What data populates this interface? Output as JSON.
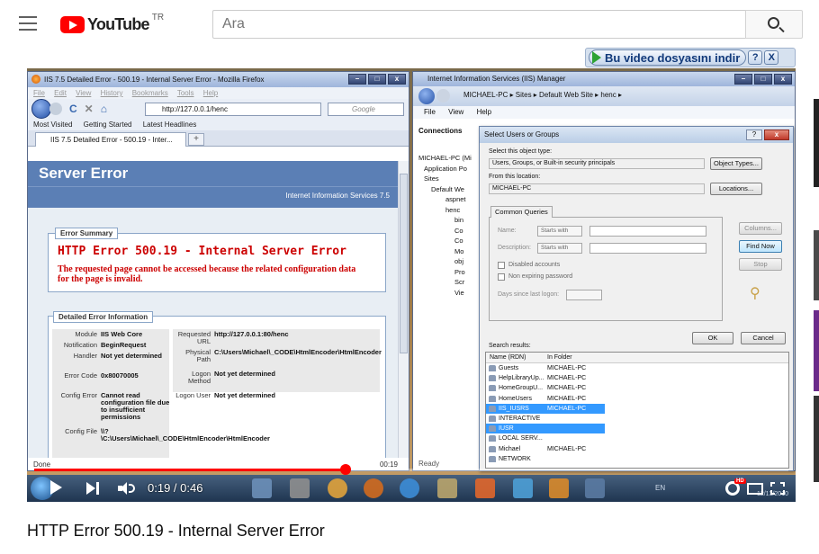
{
  "header": {
    "logo_text": "YouTube",
    "region": "TR",
    "search_placeholder": "Ara"
  },
  "download_bar": {
    "label": "Bu video dosyasını indir",
    "help": "?",
    "close": "X"
  },
  "player": {
    "time_current": "0:19",
    "time_total": "0:46",
    "progress_fraction": 0.413,
    "accent": "#ff0000"
  },
  "video_frame": {
    "firefox": {
      "window_title": "IIS 7.5 Detailed Error - 500.19 - Internal Server Error - Mozilla Firefox",
      "menu": [
        "File",
        "Edit",
        "View",
        "History",
        "Bookmarks",
        "Tools",
        "Help"
      ],
      "url": "http://127.0.0.1/henc",
      "search_engine": "Google",
      "bookmarks": [
        "Most Visited",
        "Getting Started",
        "Latest Headlines"
      ],
      "tab_title": "IIS 7.5 Detailed Error - 500.19 - Inter...",
      "tab_plus": "+",
      "server_error": "Server Error",
      "iis_version": "Internet Information Services 7.5",
      "error_summary_label": "Error Summary",
      "error_heading": "HTTP Error 500.19 - Internal Server Error",
      "error_message": "The requested page cannot be accessed because the related configuration data for the page is invalid.",
      "detailed_label": "Detailed Error Information",
      "details_left": [
        {
          "k": "Module",
          "v": "IIS Web Core"
        },
        {
          "k": "Notification",
          "v": "BeginRequest"
        },
        {
          "k": "Handler",
          "v": "Not yet determined"
        },
        {
          "k": "Error Code",
          "v": "0x80070005"
        },
        {
          "k": "Config Error",
          "v": "Cannot read configuration file due to insufficient permissions"
        },
        {
          "k": "Config File",
          "v": "\\\\?\\C:\\Users\\Michael\\_CODE\\HtmlEncoder\\HtmlEncoder"
        }
      ],
      "details_right": [
        {
          "k": "Requested URL",
          "v": "http://127.0.0.1:80/henc"
        },
        {
          "k": "Physical Path",
          "v": "C:\\Users\\Michael\\_CODE\\HtmlEncoder\\HtmlEncoder"
        },
        {
          "k": "Logon Method",
          "v": "Not yet determined"
        },
        {
          "k": "Logon User",
          "v": "Not yet determined"
        }
      ],
      "status": "Done",
      "status_time": "00:19"
    },
    "iis_manager": {
      "window_title": "Internet Information Services (IIS) Manager",
      "crumbs": "MICHAEL-PC  ▸  Sites  ▸  Default Web Site  ▸  henc  ▸",
      "menu": [
        "File",
        "View",
        "Help"
      ],
      "connections": "Connections",
      "tree": [
        "MICHAEL-PC (Mi",
        "Application Po",
        "Sites",
        "Default We",
        "aspnet",
        "henc",
        "bin",
        "Co",
        "Co",
        "Mo",
        "obj",
        "Pro",
        "Scr",
        "Vie"
      ],
      "status": "Ready"
    },
    "dialog": {
      "title": "Select Users or Groups",
      "object_type_label": "Select this object type:",
      "object_type_value": "Users, Groups, or Built-in security principals",
      "object_types_button": "Object Types...",
      "location_label": "From this location:",
      "location_value": "MICHAEL-PC",
      "locations_button": "Locations...",
      "tab_common": "Common Queries",
      "name_label": "Name:",
      "description_label": "Description:",
      "starts_with": "Starts with",
      "disabled_accounts": "Disabled accounts",
      "non_expiring": "Non expiring password",
      "days_since": "Days since last logon:",
      "columns_button": "Columns...",
      "find_now_button": "Find Now",
      "stop_button": "Stop",
      "ok_button": "OK",
      "cancel_button": "Cancel",
      "search_results": "Search results:",
      "col_name": "Name (RDN)",
      "col_folder": "In Folder",
      "rows": [
        {
          "name": "Guests",
          "folder": "MICHAEL-PC",
          "selected": false
        },
        {
          "name": "HelpLibraryUp...",
          "folder": "MICHAEL-PC",
          "selected": false
        },
        {
          "name": "HomeGroupU...",
          "folder": "MICHAEL-PC",
          "selected": false
        },
        {
          "name": "HomeUsers",
          "folder": "MICHAEL-PC",
          "selected": false
        },
        {
          "name": "IIS_IUSRS",
          "folder": "MICHAEL-PC",
          "selected": true
        },
        {
          "name": "INTERACTIVE",
          "folder": "",
          "selected": false
        },
        {
          "name": "IUSR",
          "folder": "",
          "selected": true
        },
        {
          "name": "LOCAL SERV...",
          "folder": "",
          "selected": false
        },
        {
          "name": "Michael",
          "folder": "MICHAEL-PC",
          "selected": false
        },
        {
          "name": "NETWORK",
          "folder": "",
          "selected": false
        }
      ]
    },
    "taskbar": {
      "lang": "EN",
      "date": "12/13/2010"
    }
  },
  "video_title": "HTTP Error 500.19 - Internal Server Error"
}
